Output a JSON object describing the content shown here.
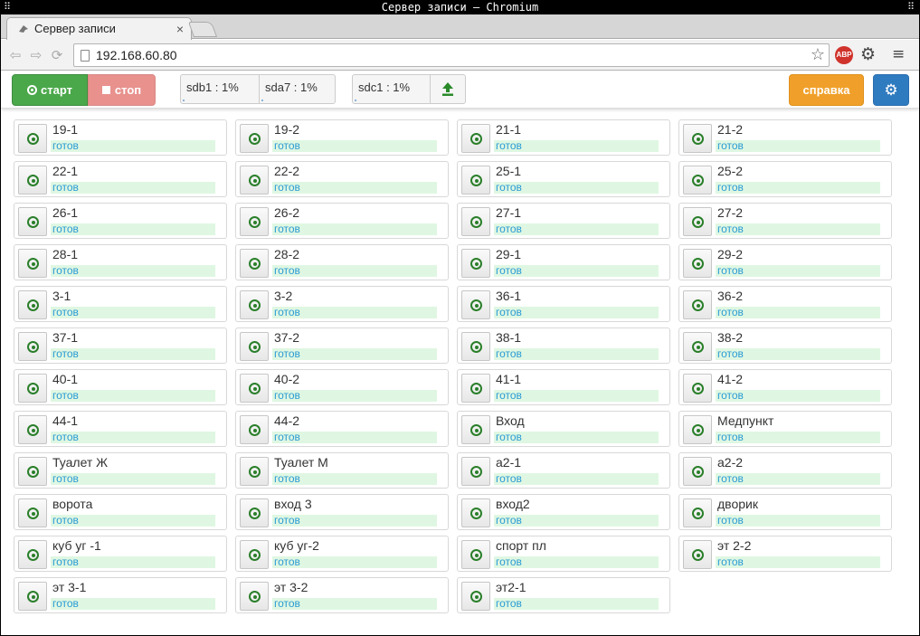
{
  "window": {
    "title": "Сервер записи — Chromium",
    "left_glyph": "⠿",
    "right_glyph": "⠿"
  },
  "tab": {
    "label": "Сервер записи",
    "close": "×"
  },
  "toolbar": {
    "back_icon": "arrow-left-icon",
    "forward_icon": "arrow-right-icon",
    "reload_icon": "reload-icon",
    "url": "192.168.60.80",
    "star_glyph": "☆",
    "abp_label": "ABP",
    "gear_glyph": "⚙",
    "menu_glyph": "≡"
  },
  "app": {
    "start_label": "старт",
    "stop_label": "стоп",
    "disks": [
      {
        "label": "sdb1 : 1%",
        "usage": 1
      },
      {
        "label": "sda7 : 1%",
        "usage": 1
      },
      {
        "label": "sdc1 : 1%",
        "usage": 1
      }
    ],
    "help_label": "справка",
    "settings_glyph": "⚙",
    "colors": {
      "start": "#4aa84a",
      "stop": "#e8918d",
      "help": "#f0a02a",
      "settings": "#2f7bc0",
      "status_text": "#2a9bd4",
      "status_bg": "#dff7e2"
    }
  },
  "cameras": [
    {
      "name": "19-1",
      "status": "готов"
    },
    {
      "name": "19-2",
      "status": "готов"
    },
    {
      "name": "21-1",
      "status": "готов"
    },
    {
      "name": "21-2",
      "status": "готов"
    },
    {
      "name": "22-1",
      "status": "готов"
    },
    {
      "name": "22-2",
      "status": "готов"
    },
    {
      "name": "25-1",
      "status": "готов"
    },
    {
      "name": "25-2",
      "status": "готов"
    },
    {
      "name": "26-1",
      "status": "готов"
    },
    {
      "name": "26-2",
      "status": "готов"
    },
    {
      "name": "27-1",
      "status": "готов"
    },
    {
      "name": "27-2",
      "status": "готов"
    },
    {
      "name": "28-1",
      "status": "готов"
    },
    {
      "name": "28-2",
      "status": "готов"
    },
    {
      "name": "29-1",
      "status": "готов"
    },
    {
      "name": "29-2",
      "status": "готов"
    },
    {
      "name": "3-1",
      "status": "готов"
    },
    {
      "name": "3-2",
      "status": "готов"
    },
    {
      "name": "36-1",
      "status": "готов"
    },
    {
      "name": "36-2",
      "status": "готов"
    },
    {
      "name": "37-1",
      "status": "готов"
    },
    {
      "name": "37-2",
      "status": "готов"
    },
    {
      "name": "38-1",
      "status": "готов"
    },
    {
      "name": "38-2",
      "status": "готов"
    },
    {
      "name": "40-1",
      "status": "готов"
    },
    {
      "name": "40-2",
      "status": "готов"
    },
    {
      "name": "41-1",
      "status": "готов"
    },
    {
      "name": "41-2",
      "status": "готов"
    },
    {
      "name": "44-1",
      "status": "готов"
    },
    {
      "name": "44-2",
      "status": "готов"
    },
    {
      "name": "Вход",
      "status": "готов"
    },
    {
      "name": "Медпункт",
      "status": "готов"
    },
    {
      "name": "Туалет Ж",
      "status": "готов"
    },
    {
      "name": "Туалет М",
      "status": "готов"
    },
    {
      "name": "а2-1",
      "status": "готов"
    },
    {
      "name": "а2-2",
      "status": "готов"
    },
    {
      "name": "ворота",
      "status": "готов"
    },
    {
      "name": "вход 3",
      "status": "готов"
    },
    {
      "name": "вход2",
      "status": "готов"
    },
    {
      "name": "дворик",
      "status": "готов"
    },
    {
      "name": "куб уг -1",
      "status": "готов"
    },
    {
      "name": "куб уг-2",
      "status": "готов"
    },
    {
      "name": "спорт пл",
      "status": "готов"
    },
    {
      "name": "эт 2-2",
      "status": "готов"
    },
    {
      "name": "эт 3-1",
      "status": "готов"
    },
    {
      "name": "эт 3-2",
      "status": "готов"
    },
    {
      "name": "эт2-1",
      "status": "готов"
    }
  ]
}
